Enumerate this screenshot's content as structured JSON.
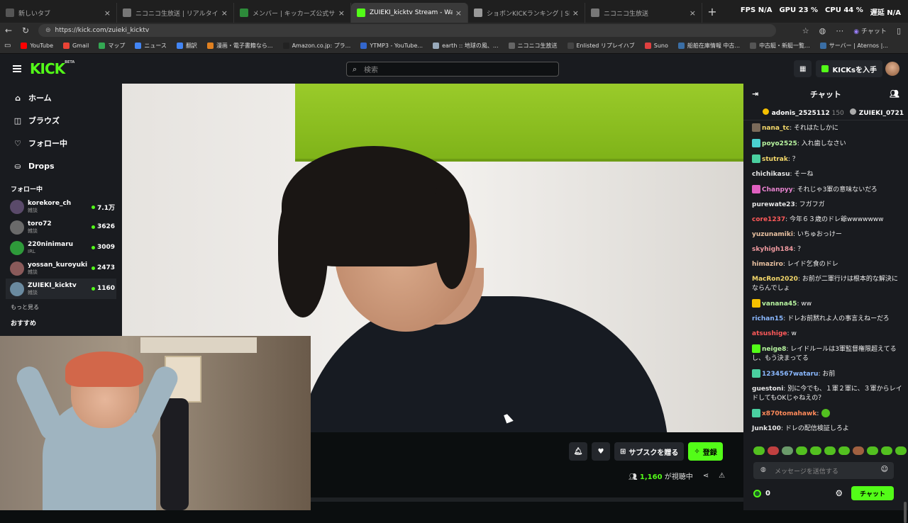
{
  "browser": {
    "tabs": [
      {
        "title": "新しいタブ",
        "color": "#555555"
      },
      {
        "title": "ニコニコ生放送 | リアルタイムランキング",
        "color": "#777777"
      },
      {
        "title": "メンバー | キッカーズ公式サイト",
        "color": "#2d8a3a"
      },
      {
        "title": "ZUIEKI_kicktv Stream - Watch Live",
        "color": "#53fc18"
      },
      {
        "title": "ショボンKICKランキング | Shobon Kick",
        "color": "#999999"
      },
      {
        "title": "ニコニコ生放送",
        "color": "#777777"
      }
    ],
    "stats": {
      "fps": "FPS",
      "fps_val": "N/A",
      "gpu": "GPU",
      "gpu_val": "23 %",
      "cpu": "CPU",
      "cpu_val": "44 %",
      "misc": "遅延",
      "misc_val": "N/A"
    },
    "url": "https://kick.com/zuieki_kicktv",
    "profile_label": "チャット",
    "bookmarks": [
      {
        "label": "YouTube",
        "color": "#ff0000"
      },
      {
        "label": "Gmail",
        "color": "#ea4335"
      },
      {
        "label": "マップ",
        "color": "#34a853"
      },
      {
        "label": "ニュース",
        "color": "#4285f4"
      },
      {
        "label": "翻訳",
        "color": "#4285f4"
      },
      {
        "label": "漫画・電子書籍なら...",
        "color": "#e08020"
      },
      {
        "label": "Amazon.co.jp: プラ...",
        "color": "#222222"
      },
      {
        "label": "YTMP3 - YouTube...",
        "color": "#3366cc"
      },
      {
        "label": "earth :: 地球の風、...",
        "color": "#9ab"
      },
      {
        "label": "ニコニコ生放送",
        "color": "#666666"
      },
      {
        "label": "Enlisted リプレイハブ",
        "color": "#444444"
      },
      {
        "label": "Suno",
        "color": "#e04040"
      },
      {
        "label": "船舶在庫情報 中古...",
        "color": "#3a6ea5"
      },
      {
        "label": "中古艇・新艇一覧...",
        "color": "#555555"
      },
      {
        "label": "サーバー | Aternos |...",
        "color": "#3a6ea5"
      }
    ]
  },
  "kick": {
    "logo": "KICK",
    "logo_badge": "BETA",
    "search_placeholder": "検索",
    "get_kicks": "KICKsを入手",
    "accent": "#53fc18",
    "nav": [
      {
        "label": "ホーム",
        "icon": "home-icon",
        "glyph": "⌂"
      },
      {
        "label": "ブラウズ",
        "icon": "browse-icon",
        "glyph": "◫"
      },
      {
        "label": "フォロー中",
        "icon": "heart-icon",
        "glyph": "♡"
      },
      {
        "label": "Drops",
        "icon": "drops-icon",
        "glyph": "⛀"
      }
    ],
    "following_title": "フォロー中",
    "following": [
      {
        "name": "korekore_ch",
        "category": "雑談",
        "viewers": "7.1万",
        "color": "#5a4a6a"
      },
      {
        "name": "toro72",
        "category": "雑談",
        "viewers": "3626",
        "color": "#6a6a6a"
      },
      {
        "name": "220ninimaru",
        "category": "IRL",
        "viewers": "3009",
        "color": "#2e9a3a"
      },
      {
        "name": "yossan_kuroyuki",
        "category": "雑談",
        "viewers": "2473",
        "color": "#8a5a5a"
      },
      {
        "name": "ZUIEKI_kicktv",
        "category": "雑談",
        "viewers": "1160",
        "color": "#6a8aa0"
      }
    ],
    "show_more": "もっと見る",
    "recommended_title": "おすすめ",
    "actions": {
      "gift_label": "サブスクを贈る",
      "subscribe_label": "登録"
    },
    "viewers_count": "1,160",
    "viewers_suffix": "が視聴中"
  },
  "chat": {
    "title": "チャット",
    "pinned": [
      {
        "user": "adonis_2525112",
        "count": "150"
      },
      {
        "user": "ZUIEKI_0721",
        "count": ""
      }
    ],
    "messages": [
      {
        "user": "nana_tc",
        "color": "#f5d96b",
        "badge": "#7a6a5a",
        "text": ": それはたしかに"
      },
      {
        "user": "poyo2525",
        "color": "#b8f5a0",
        "badge": "#4ad0d0",
        "text": ": 入れ歯しなさい"
      },
      {
        "user": "stutrak",
        "color": "#f5d96b",
        "badge": "#4ad0a0",
        "text": ": ？"
      },
      {
        "user": "chichikasu",
        "color": "#e6e6e6",
        "badge": "",
        "text": ": そーね"
      },
      {
        "user": "Chanpyy",
        "color": "#e884d0",
        "badge": "#e060c0",
        "text": ": それじゃ3軍の意味ないだろ"
      },
      {
        "user": "purewate23",
        "color": "#e6e6e6",
        "badge": "",
        "text": ": フガフガ"
      },
      {
        "user": "core1237",
        "color": "#ff5a5a",
        "badge": "",
        "text": ": 今年６３歳のドレ爺wwwwwww"
      },
      {
        "user": "yuzunamiki",
        "color": "#e8c0a0",
        "badge": "",
        "text": ": いちゅおっけー"
      },
      {
        "user": "skyhigh184",
        "color": "#f09aa0",
        "badge": "",
        "text": ": ？"
      },
      {
        "user": "himaziro",
        "color": "#e8c0a0",
        "badge": "",
        "text": ": レイド乞食のドレ"
      },
      {
        "user": "MacRon2020",
        "color": "#f5d96b",
        "badge": "",
        "text": ": お前が二軍行けは根本的な解決にならんでしょ"
      },
      {
        "user": "vanana45",
        "color": "#b8f5a0",
        "badge": "#f5c000",
        "text": ": ww"
      },
      {
        "user": "richan15",
        "color": "#8ab8ff",
        "badge": "",
        "text": ": ドレお前黙れよ人の事言えねーだろ"
      },
      {
        "user": "atsushige",
        "color": "#ff5a5a",
        "badge": "",
        "text": ": w"
      },
      {
        "user": "neige8",
        "color": "#b8f5a0",
        "badge": "#53fc18",
        "text": ": レイドルールは3軍監督権限超えてるし、もう決まってる"
      },
      {
        "user": "1234567wataru",
        "color": "#8ab8ff",
        "badge": "#4ad0a0",
        "text": ": お前"
      },
      {
        "user": "guestoni",
        "color": "#e6e6e6",
        "badge": "",
        "text": ": 別に今でも、１軍２軍に、３軍からレイドしてもOKじゃねえの？"
      },
      {
        "user": "x870tomahawk",
        "color": "#ff8a5a",
        "badge": "#4ad0a0",
        "text": ":"
      },
      {
        "user": "Junk100",
        "color": "#e6e6e6",
        "badge": "",
        "text": ": ドレの配信検証しろよ"
      }
    ],
    "emote_colors": [
      "#53c020",
      "#c04040",
      "#6a9a6a",
      "#53c020",
      "#53c020",
      "#53c020",
      "#53c020",
      "#a06040",
      "#53c020",
      "#53c020",
      "#53c020"
    ],
    "input_placeholder": "メッセージを送信する",
    "points": "0",
    "send_label": "チャット"
  }
}
